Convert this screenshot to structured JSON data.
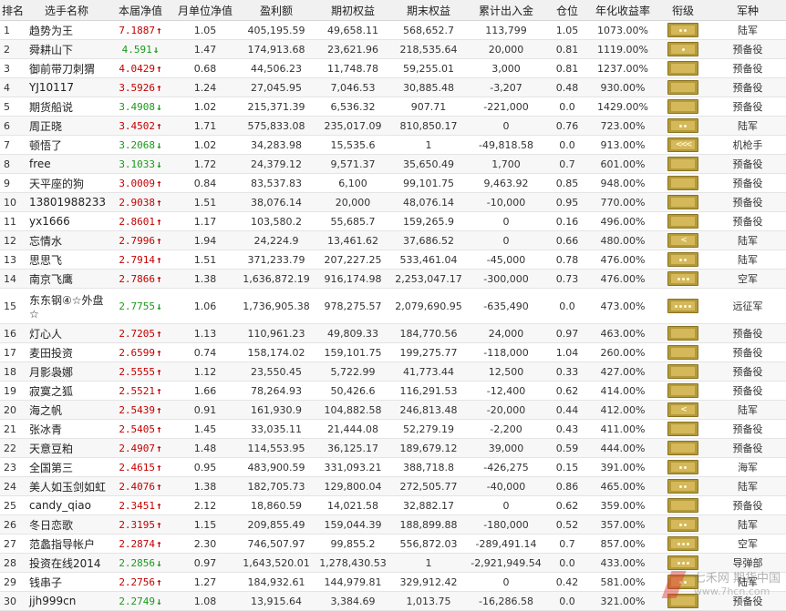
{
  "headers": [
    "排名",
    "选手名称",
    "本届净值",
    "月单位净值",
    "盈利额",
    "期初权益",
    "期末权益",
    "累计出入金",
    "仓位",
    "年化收益率",
    "衔级",
    "军种"
  ],
  "rows": [
    {
      "rank": "1",
      "name": "趋势为王",
      "nav": "7.1887",
      "dir": "up",
      "monthly": "1.05",
      "profit": "405,195.59",
      "start": "49,658.11",
      "end": "568,652.7",
      "cum": "113,799",
      "pos": "1.05",
      "annual": "1073.00%",
      "insignia": "two-star",
      "branch": "陆军"
    },
    {
      "rank": "2",
      "name": "舜耕山下",
      "nav": "4.591",
      "dir": "down",
      "monthly": "1.47",
      "profit": "174,913.68",
      "start": "23,621.96",
      "end": "218,535.64",
      "cum": "20,000",
      "pos": "0.81",
      "annual": "1119.00%",
      "insignia": "one-star",
      "branch": "预备役"
    },
    {
      "rank": "3",
      "name": "御前带刀刺猬",
      "nav": "4.0429",
      "dir": "up",
      "monthly": "0.68",
      "profit": "44,506.23",
      "start": "11,748.78",
      "end": "59,255.01",
      "cum": "3,000",
      "pos": "0.81",
      "annual": "1237.00%",
      "insignia": "stripe",
      "branch": "预备役"
    },
    {
      "rank": "4",
      "name": "YJ10117",
      "nav": "3.5926",
      "dir": "up",
      "monthly": "1.24",
      "profit": "27,045.95",
      "start": "7,046.53",
      "end": "30,885.48",
      "cum": "-3,207",
      "pos": "0.48",
      "annual": "930.00%",
      "insignia": "stripe",
      "branch": "预备役"
    },
    {
      "rank": "5",
      "name": "期货船说",
      "nav": "3.4908",
      "dir": "down",
      "monthly": "1.02",
      "profit": "215,371.39",
      "start": "6,536.32",
      "end": "907.71",
      "cum": "-221,000",
      "pos": "0.0",
      "annual": "1429.00%",
      "insignia": "stripe",
      "branch": "预备役"
    },
    {
      "rank": "6",
      "name": "周正晓",
      "nav": "3.4502",
      "dir": "up",
      "monthly": "1.71",
      "profit": "575,833.08",
      "start": "235,017.09",
      "end": "810,850.17",
      "cum": "0",
      "pos": "0.76",
      "annual": "723.00%",
      "insignia": "two-star",
      "branch": "陆军"
    },
    {
      "rank": "7",
      "name": "顿悟了",
      "nav": "3.2068",
      "dir": "down",
      "monthly": "1.02",
      "profit": "34,283.98",
      "start": "15,535.6",
      "end": "1",
      "cum": "-49,818.58",
      "pos": "0.0",
      "annual": "913.00%",
      "insignia": "chevron3",
      "branch": "机枪手"
    },
    {
      "rank": "8",
      "name": "free",
      "nav": "3.1033",
      "dir": "down",
      "monthly": "1.72",
      "profit": "24,379.12",
      "start": "9,571.37",
      "end": "35,650.49",
      "cum": "1,700",
      "pos": "0.7",
      "annual": "601.00%",
      "insignia": "stripe",
      "branch": "预备役"
    },
    {
      "rank": "9",
      "name": "天平座的狗",
      "nav": "3.0009",
      "dir": "up",
      "monthly": "0.84",
      "profit": "83,537.83",
      "start": "6,100",
      "end": "99,101.75",
      "cum": "9,463.92",
      "pos": "0.85",
      "annual": "948.00%",
      "insignia": "stripe",
      "branch": "预备役"
    },
    {
      "rank": "10",
      "name": "13801988233",
      "nav": "2.9038",
      "dir": "up",
      "monthly": "1.51",
      "profit": "38,076.14",
      "start": "20,000",
      "end": "48,076.14",
      "cum": "-10,000",
      "pos": "0.95",
      "annual": "770.00%",
      "insignia": "stripe",
      "branch": "预备役"
    },
    {
      "rank": "11",
      "name": "yx1666",
      "nav": "2.8601",
      "dir": "up",
      "monthly": "1.17",
      "profit": "103,580.2",
      "start": "55,685.7",
      "end": "159,265.9",
      "cum": "0",
      "pos": "0.16",
      "annual": "496.00%",
      "insignia": "stripe",
      "branch": "预备役"
    },
    {
      "rank": "12",
      "name": "忘情水",
      "nav": "2.7996",
      "dir": "up",
      "monthly": "1.94",
      "profit": "24,224.9",
      "start": "13,461.62",
      "end": "37,686.52",
      "cum": "0",
      "pos": "0.66",
      "annual": "480.00%",
      "insignia": "chevron1",
      "branch": "陆军"
    },
    {
      "rank": "13",
      "name": "思思飞",
      "nav": "2.7914",
      "dir": "up",
      "monthly": "1.51",
      "profit": "371,233.79",
      "start": "207,227.25",
      "end": "533,461.04",
      "cum": "-45,000",
      "pos": "0.78",
      "annual": "476.00%",
      "insignia": "two-star",
      "branch": "陆军"
    },
    {
      "rank": "14",
      "name": "南京飞鹰",
      "nav": "2.7866",
      "dir": "up",
      "monthly": "1.38",
      "profit": "1,636,872.19",
      "start": "916,174.98",
      "end": "2,253,047.17",
      "cum": "-300,000",
      "pos": "0.73",
      "annual": "476.00%",
      "insignia": "three-star",
      "branch": "空军"
    },
    {
      "rank": "15",
      "name": "东东钢④☆外盘☆",
      "nav": "2.7755",
      "dir": "down",
      "monthly": "1.06",
      "profit": "1,736,905.38",
      "start": "978,275.57",
      "end": "2,079,690.95",
      "cum": "-635,490",
      "pos": "0.0",
      "annual": "473.00%",
      "insignia": "four-star",
      "branch": "远征军",
      "tall": true
    },
    {
      "rank": "16",
      "name": "灯心人",
      "nav": "2.7205",
      "dir": "up",
      "monthly": "1.13",
      "profit": "110,961.23",
      "start": "49,809.33",
      "end": "184,770.56",
      "cum": "24,000",
      "pos": "0.97",
      "annual": "463.00%",
      "insignia": "stripe",
      "branch": "预备役"
    },
    {
      "rank": "17",
      "name": "麦田投资",
      "nav": "2.6599",
      "dir": "up",
      "monthly": "0.74",
      "profit": "158,174.02",
      "start": "159,101.75",
      "end": "199,275.77",
      "cum": "-118,000",
      "pos": "1.04",
      "annual": "260.00%",
      "insignia": "stripe",
      "branch": "预备役"
    },
    {
      "rank": "18",
      "name": "月影袅娜",
      "nav": "2.5555",
      "dir": "up",
      "monthly": "1.12",
      "profit": "23,550.45",
      "start": "5,722.99",
      "end": "41,773.44",
      "cum": "12,500",
      "pos": "0.33",
      "annual": "427.00%",
      "insignia": "stripe",
      "branch": "预备役"
    },
    {
      "rank": "19",
      "name": "寂寞之狐",
      "nav": "2.5521",
      "dir": "up",
      "monthly": "1.66",
      "profit": "78,264.93",
      "start": "50,426.6",
      "end": "116,291.53",
      "cum": "-12,400",
      "pos": "0.62",
      "annual": "414.00%",
      "insignia": "stripe",
      "branch": "预备役"
    },
    {
      "rank": "20",
      "name": "海之帆",
      "nav": "2.5439",
      "dir": "up",
      "monthly": "0.91",
      "profit": "161,930.9",
      "start": "104,882.58",
      "end": "246,813.48",
      "cum": "-20,000",
      "pos": "0.44",
      "annual": "412.00%",
      "insignia": "chevron1",
      "branch": "陆军"
    },
    {
      "rank": "21",
      "name": "张冰青",
      "nav": "2.5405",
      "dir": "up",
      "monthly": "1.45",
      "profit": "33,035.11",
      "start": "21,444.08",
      "end": "52,279.19",
      "cum": "-2,200",
      "pos": "0.43",
      "annual": "411.00%",
      "insignia": "stripe",
      "branch": "预备役"
    },
    {
      "rank": "22",
      "name": "天意豆粕",
      "nav": "2.4907",
      "dir": "up",
      "monthly": "1.48",
      "profit": "114,553.95",
      "start": "36,125.17",
      "end": "189,679.12",
      "cum": "39,000",
      "pos": "0.59",
      "annual": "444.00%",
      "insignia": "stripe",
      "branch": "预备役"
    },
    {
      "rank": "23",
      "name": "全国第三",
      "nav": "2.4615",
      "dir": "up",
      "monthly": "0.95",
      "profit": "483,900.59",
      "start": "331,093.21",
      "end": "388,718.8",
      "cum": "-426,275",
      "pos": "0.15",
      "annual": "391.00%",
      "insignia": "two-star",
      "branch": "海军"
    },
    {
      "rank": "24",
      "name": "美人如玉剑如虹",
      "nav": "2.4076",
      "dir": "up",
      "monthly": "1.38",
      "profit": "182,705.73",
      "start": "129,800.04",
      "end": "272,505.77",
      "cum": "-40,000",
      "pos": "0.86",
      "annual": "465.00%",
      "insignia": "two-star",
      "branch": "陆军"
    },
    {
      "rank": "25",
      "name": "candy_qiao",
      "nav": "2.3451",
      "dir": "up",
      "monthly": "2.12",
      "profit": "18,860.59",
      "start": "14,021.58",
      "end": "32,882.17",
      "cum": "0",
      "pos": "0.62",
      "annual": "359.00%",
      "insignia": "stripe",
      "branch": "预备役"
    },
    {
      "rank": "26",
      "name": "冬日恋歌",
      "nav": "2.3195",
      "dir": "up",
      "monthly": "1.15",
      "profit": "209,855.49",
      "start": "159,044.39",
      "end": "188,899.88",
      "cum": "-180,000",
      "pos": "0.52",
      "annual": "357.00%",
      "insignia": "two-star",
      "branch": "陆军"
    },
    {
      "rank": "27",
      "name": "范蠡指导帐户",
      "nav": "2.2874",
      "dir": "up",
      "monthly": "2.30",
      "profit": "746,507.97",
      "start": "99,855.2",
      "end": "556,872.03",
      "cum": "-289,491.14",
      "pos": "0.7",
      "annual": "857.00%",
      "insignia": "three-star",
      "branch": "空军"
    },
    {
      "rank": "28",
      "name": "投资在线2014",
      "nav": "2.2856",
      "dir": "down",
      "monthly": "0.97",
      "profit": "1,643,520.01",
      "start": "1,278,430.53",
      "end": "1",
      "cum": "-2,921,949.54",
      "pos": "0.0",
      "annual": "433.00%",
      "insignia": "three-star",
      "branch": "导弹部"
    },
    {
      "rank": "29",
      "name": "钱串子",
      "nav": "2.2756",
      "dir": "up",
      "monthly": "1.27",
      "profit": "184,932.61",
      "start": "144,979.81",
      "end": "329,912.42",
      "cum": "0",
      "pos": "0.42",
      "annual": "581.00%",
      "insignia": "two-star",
      "branch": "陆军"
    },
    {
      "rank": "30",
      "name": "jjh999cn",
      "nav": "2.2749",
      "dir": "down",
      "monthly": "1.08",
      "profit": "13,915.64",
      "start": "3,384.69",
      "end": "1,013.75",
      "cum": "-16,286.58",
      "pos": "0.0",
      "annual": "321.00%",
      "insignia": "stripe",
      "branch": "预备役"
    }
  ],
  "watermark": {
    "text": "七禾网 期货中国",
    "url": "www.7hcn.com"
  },
  "colors": {
    "up": "#c40000",
    "down": "#1a9a1a",
    "badge": "#b59a3a",
    "header_bg": "#f1f1f1"
  }
}
